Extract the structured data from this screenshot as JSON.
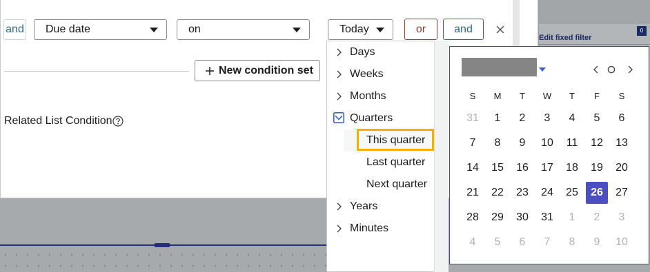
{
  "condition_row": {
    "connector_label": "and",
    "field_value": "Due date",
    "operator_value": "on",
    "date_value": "Today",
    "or_label": "or",
    "and_label": "and"
  },
  "new_condition_set_label": "New condition set",
  "related_list_label": "Related List Condition",
  "background": {
    "edit_fixed_filter": "Edit fixed filter",
    "badge": "0"
  },
  "date_menu": {
    "items": [
      {
        "label": "Days"
      },
      {
        "label": "Weeks"
      },
      {
        "label": "Months"
      },
      {
        "label": "Quarters",
        "expanded": true
      },
      {
        "label": "Years"
      },
      {
        "label": "Minutes"
      }
    ],
    "quarters_sub": [
      {
        "label": "This quarter",
        "selected": true
      },
      {
        "label": "Last quarter"
      },
      {
        "label": "Next quarter"
      }
    ]
  },
  "calendar": {
    "weekdays": [
      "S",
      "M",
      "T",
      "W",
      "T",
      "F",
      "S"
    ],
    "weeks": [
      [
        "31",
        "1",
        "2",
        "3",
        "4",
        "5",
        "6"
      ],
      [
        "7",
        "8",
        "9",
        "10",
        "11",
        "12",
        "13"
      ],
      [
        "14",
        "15",
        "16",
        "17",
        "18",
        "19",
        "20"
      ],
      [
        "21",
        "22",
        "23",
        "24",
        "25",
        "26",
        "27"
      ],
      [
        "28",
        "29",
        "30",
        "31",
        "1",
        "2",
        "3"
      ],
      [
        "4",
        "5",
        "6",
        "7",
        "8",
        "9",
        "10"
      ]
    ],
    "selected_day": "26",
    "accent_color": "#4b4fc0"
  },
  "colors": {
    "focus_outline": "#f2b100",
    "or_button": "#9b3a2a",
    "and_button": "#2e6b8a"
  }
}
